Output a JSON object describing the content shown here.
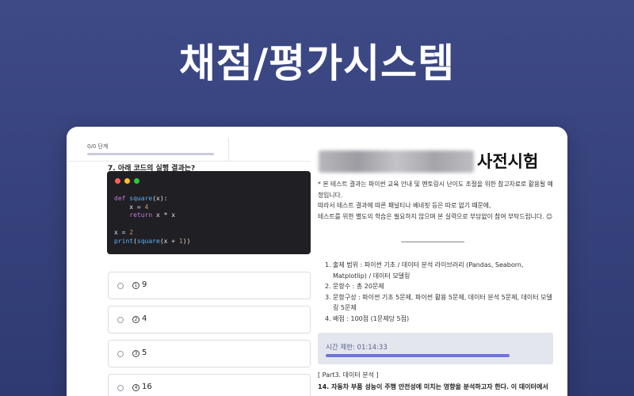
{
  "banner": {
    "title": "채점/평가시스템"
  },
  "quiz": {
    "progress_text": "0/0 단계",
    "progress_fraction": 0.0,
    "question": "7. 아래 코드의 실행 결과는?",
    "code_lines": [
      "def square(x):",
      "    x = 4",
      "    return x * x",
      "",
      "x = 2",
      "print(square(x + 1))"
    ],
    "window_dot_colors": [
      "#ff5f56",
      "#ffbd2e",
      "#27c93f"
    ],
    "options": [
      {
        "marker": "1",
        "label": "9"
      },
      {
        "marker": "2",
        "label": "4"
      },
      {
        "marker": "3",
        "label": "5"
      },
      {
        "marker": "4",
        "label": "16"
      }
    ]
  },
  "exam": {
    "title": "사전시험",
    "notice_1": "* 본 테스트 결과는 파이썬 교육 안내 및 멘토링시 난이도 조절을 위한 참고자료로 활용될 예정입니다.",
    "notice_2": "따라서 테스트 결과에 따른 패널티나 베네핏 등은 따로 없기 때문에,",
    "notice_3": "테스트를 위한 별도의 학습은 필요하지 않으며 본 실력으로 부담없이 참여 부탁드립니다. 😊",
    "info": [
      {
        "n": "1.",
        "text": "출제 범위 : 파이썬 기초 / 데이터 분석 라이브러리 (Pandas, Seaborn, Matplotlip) / 데이터 모델링"
      },
      {
        "n": "2.",
        "text": "문항수 : 총 20문제"
      },
      {
        "n": "3.",
        "text": "문항구성 : 파이썬 기초 5문제, 파이썬 활용 5문제, 데이터 분석 5문제, 데이터 모델링 5문제"
      },
      {
        "n": "4.",
        "text": "배점 : 100점 (1문제당 5점)"
      }
    ],
    "timer_label": "시간 제한: 01:14:33",
    "timer_fraction": 0.78,
    "part_label": "[ Part3. 데이터 분석 ]",
    "q14": "14. 자동차 부품 성능이 주행 안전성에 미치는 영향을 분석하고자 한다. 이 데이터에서"
  }
}
